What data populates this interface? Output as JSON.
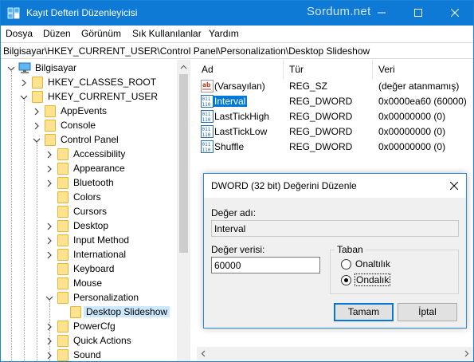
{
  "window": {
    "title": "Kayıt Defteri Düzenleyicisi",
    "watermark": "Sordum.net",
    "accent_color": "#0f7ad5"
  },
  "menu": [
    "Dosya",
    "Düzen",
    "Görünüm",
    "Sık Kullanılanlar",
    "Yardım"
  ],
  "address": {
    "path": "Bilgisayar\\HKEY_CURRENT_USER\\Control Panel\\Personalization\\Desktop Slideshow"
  },
  "tree": {
    "items": [
      {
        "label": "Bilgisayar",
        "icon": "computer-icon",
        "state": "expanded"
      },
      {
        "label": "HKEY_CLASSES_ROOT",
        "icon": "folder-icon",
        "state": "collapsed"
      },
      {
        "label": "HKEY_CURRENT_USER",
        "icon": "folder-icon",
        "state": "expanded"
      },
      {
        "label": "AppEvents",
        "icon": "folder-icon",
        "state": "collapsed"
      },
      {
        "label": "Console",
        "icon": "folder-icon",
        "state": "collapsed"
      },
      {
        "label": "Control Panel",
        "icon": "folder-icon",
        "state": "expanded"
      },
      {
        "label": "Accessibility",
        "icon": "folder-icon",
        "state": "collapsed"
      },
      {
        "label": "Appearance",
        "icon": "folder-icon",
        "state": "collapsed"
      },
      {
        "label": "Bluetooth",
        "icon": "folder-icon",
        "state": "collapsed"
      },
      {
        "label": "Colors",
        "icon": "folder-icon",
        "state": "leaf"
      },
      {
        "label": "Cursors",
        "icon": "folder-icon",
        "state": "leaf"
      },
      {
        "label": "Desktop",
        "icon": "folder-icon",
        "state": "collapsed"
      },
      {
        "label": "Input Method",
        "icon": "folder-icon",
        "state": "collapsed"
      },
      {
        "label": "International",
        "icon": "folder-icon",
        "state": "collapsed"
      },
      {
        "label": "Keyboard",
        "icon": "folder-icon",
        "state": "leaf"
      },
      {
        "label": "Mouse",
        "icon": "folder-icon",
        "state": "leaf"
      },
      {
        "label": "Personalization",
        "icon": "folder-icon",
        "state": "expanded"
      },
      {
        "label": "Desktop Slideshow",
        "icon": "folder-icon",
        "state": "selected"
      },
      {
        "label": "PowerCfg",
        "icon": "folder-icon",
        "state": "collapsed"
      },
      {
        "label": "Quick Actions",
        "icon": "folder-icon",
        "state": "collapsed"
      },
      {
        "label": "Sound",
        "icon": "folder-icon",
        "state": "collapsed"
      }
    ]
  },
  "list": {
    "columns": [
      "Ad",
      "Tür",
      "Veri"
    ],
    "rows": [
      {
        "name": "(Varsayılan)",
        "type": "REG_SZ",
        "data": "(değer atanmamış)",
        "icon": "string-value-icon"
      },
      {
        "name": "Interval",
        "type": "REG_DWORD",
        "data": "0x0000ea60 (60000)",
        "icon": "binary-value-icon"
      },
      {
        "name": "LastTickHigh",
        "type": "REG_DWORD",
        "data": "0x00000000 (0)",
        "icon": "binary-value-icon"
      },
      {
        "name": "LastTickLow",
        "type": "REG_DWORD",
        "data": "0x00000000 (0)",
        "icon": "binary-value-icon"
      },
      {
        "name": "Shuffle",
        "type": "REG_DWORD",
        "data": "0x00000000 (0)",
        "icon": "binary-value-icon"
      }
    ],
    "selected_row": "Interval"
  },
  "dialog": {
    "title": "DWORD (32 bit) Değerini Düzenle",
    "value_name_label": "Değer adı:",
    "value_name": "Interval",
    "value_data_label": "Değer verisi:",
    "value_data": "60000",
    "base_label": "Taban",
    "base_options": [
      "Onaltılık",
      "Ondalık"
    ],
    "base_selected": "Ondalık",
    "ok_label": "Tamam",
    "cancel_label": "İptal"
  }
}
